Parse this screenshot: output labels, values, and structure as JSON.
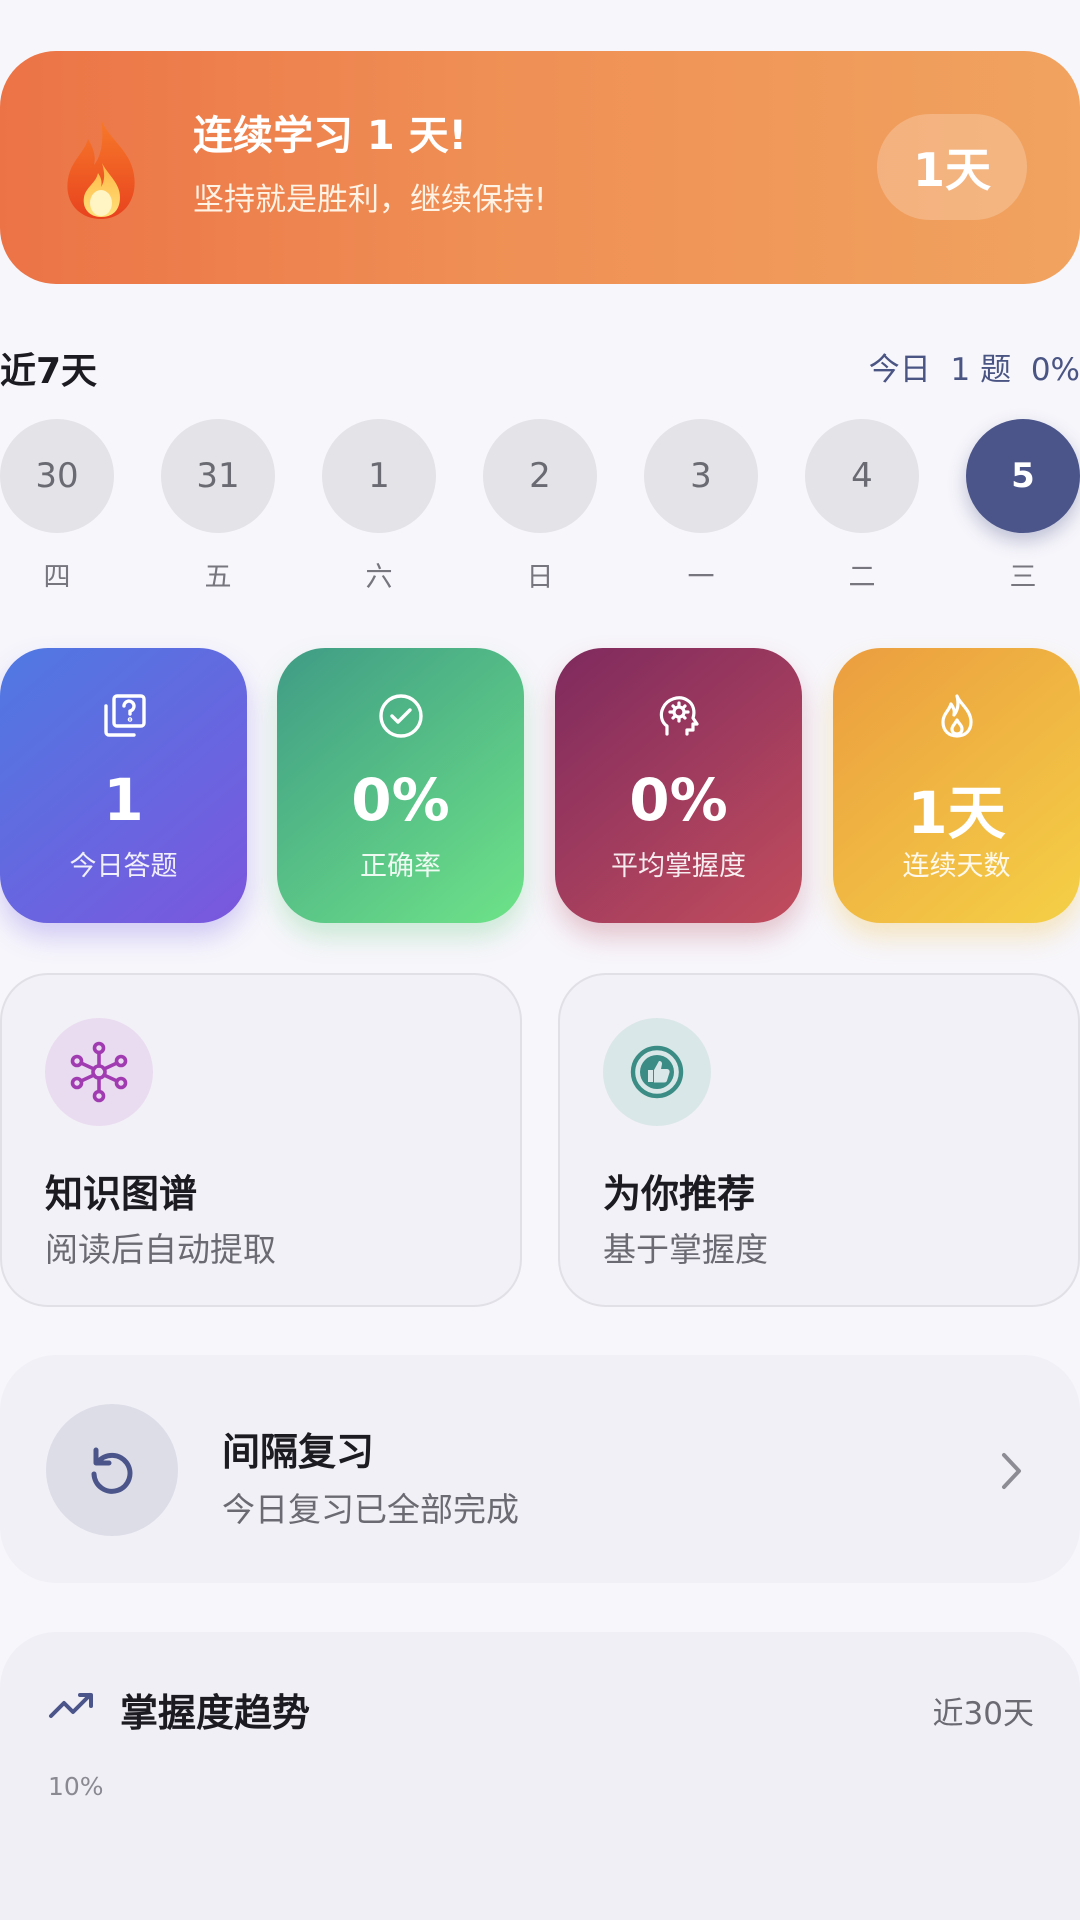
{
  "streak": {
    "title": "连续学习 1 天!",
    "subtitle": "坚持就是胜利，继续保持!",
    "badge": "1天",
    "icon": "fire-icon"
  },
  "week": {
    "title": "近7天",
    "today_label": "今日",
    "today_count": "1 题",
    "today_rate": "0%",
    "days": [
      {
        "date": "30",
        "weekday": "四",
        "active": false
      },
      {
        "date": "31",
        "weekday": "五",
        "active": false
      },
      {
        "date": "1",
        "weekday": "六",
        "active": false
      },
      {
        "date": "2",
        "weekday": "日",
        "active": false
      },
      {
        "date": "3",
        "weekday": "一",
        "active": false
      },
      {
        "date": "4",
        "weekday": "二",
        "active": false
      },
      {
        "date": "5",
        "weekday": "三",
        "active": true
      }
    ]
  },
  "stats": [
    {
      "value": "1",
      "label": "今日答题",
      "icon": "question-cards-icon"
    },
    {
      "value": "0%",
      "label": "正确率",
      "icon": "check-circle-icon"
    },
    {
      "value": "0%",
      "label": "平均掌握度",
      "icon": "brain-head-icon"
    },
    {
      "value": "1天",
      "label": "连续天数",
      "icon": "flame-icon"
    }
  ],
  "features": [
    {
      "title": "知识图谱",
      "subtitle": "阅读后自动提取",
      "icon": "network-icon",
      "color": "#a13bb1"
    },
    {
      "title": "为你推荐",
      "subtitle": "基于掌握度",
      "icon": "thumbs-up-icon",
      "color": "#3a8c84"
    }
  ],
  "review": {
    "title": "间隔复习",
    "subtitle": "今日复习已全部完成",
    "icon": "replay-icon"
  },
  "trend": {
    "title": "掌握度趋势",
    "range": "近30天",
    "y_top_label": "10%",
    "icon": "trending-up-icon"
  },
  "colors": {
    "accent": "#4b558a",
    "streak_start": "#ec7346",
    "streak_end": "#f1a35f"
  }
}
